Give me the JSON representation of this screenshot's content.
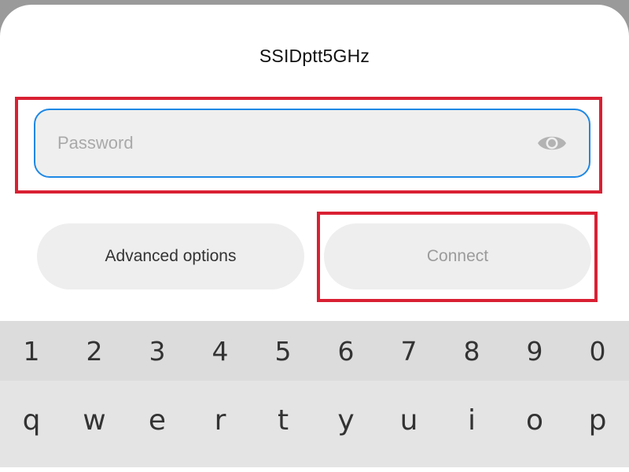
{
  "dialog": {
    "title": "SSIDptt5GHz",
    "password_placeholder": "Password",
    "password_value": "",
    "visibility_icon": "eye-icon"
  },
  "buttons": {
    "advanced_label": "Advanced options",
    "connect_label": "Connect"
  },
  "keyboard": {
    "number_row": [
      "1",
      "2",
      "3",
      "4",
      "5",
      "6",
      "7",
      "8",
      "9",
      "0"
    ],
    "top_row": [
      "q",
      "w",
      "e",
      "r",
      "t",
      "y",
      "u",
      "i",
      "o",
      "p"
    ]
  },
  "colors": {
    "highlight": "#d92033",
    "focus_border": "#1e88e5",
    "field_bg": "#efefef",
    "button_bg": "#eeeeee",
    "keyboard_bg": "#e2e2e2"
  }
}
